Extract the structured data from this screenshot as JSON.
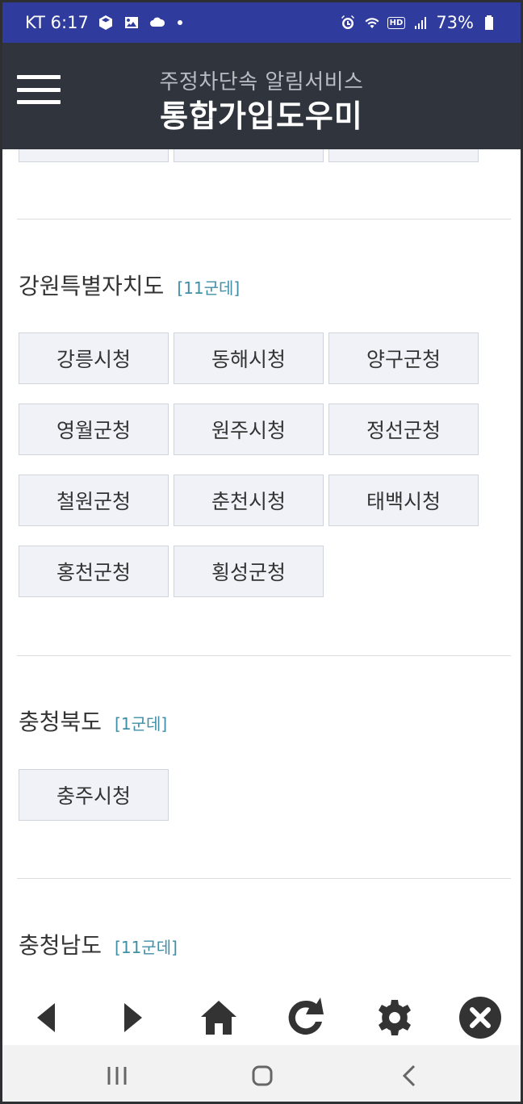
{
  "status_bar": {
    "carrier_time": "KT 6:17",
    "battery": "73%",
    "hd_label": "HD",
    "icons": [
      "cube-icon",
      "image-icon",
      "cloud-icon",
      "alarm-icon",
      "wifi-icon",
      "signal-icon",
      "battery-icon"
    ]
  },
  "header": {
    "subtitle": "주정차단속 알림서비스",
    "title": "통합가입도우미",
    "menu_icon": "hamburger-menu-icon"
  },
  "regions": [
    {
      "name": "강원특별자치도",
      "count": "[11군데]",
      "items": [
        "강릉시청",
        "동해시청",
        "양구군청",
        "영월군청",
        "원주시청",
        "정선군청",
        "철원군청",
        "춘천시청",
        "태백시청",
        "홍천군청",
        "횡성군청"
      ]
    },
    {
      "name": "충청북도",
      "count": "[1군데]",
      "items": [
        "충주시청"
      ]
    },
    {
      "name": "충청남도",
      "count": "[11군데]",
      "items": []
    }
  ],
  "toolbar": {
    "icons": [
      "back-arrow-icon",
      "forward-arrow-icon",
      "home-icon",
      "refresh-icon",
      "settings-gear-icon",
      "close-icon"
    ]
  },
  "nav_bar": {
    "icons": [
      "recent-apps-icon",
      "home-circle-icon",
      "back-chevron-icon"
    ]
  }
}
